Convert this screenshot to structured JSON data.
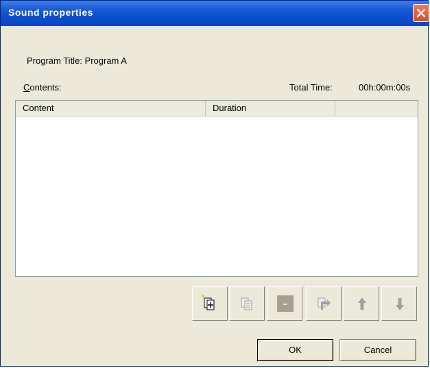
{
  "window": {
    "title": "Sound properties",
    "close_icon": "close-icon"
  },
  "program_title": {
    "text": "Program Title: Program A"
  },
  "contents": {
    "label_first": "C",
    "label_rest": "ontents:"
  },
  "total_time": {
    "label": "Total Time:",
    "value": "00h:00m:00s"
  },
  "list": {
    "columns": [
      "Content",
      "Duration",
      ""
    ],
    "rows": []
  },
  "toolbar": {
    "buttons": [
      {
        "name": "add-content-button",
        "icon": "add-item-icon",
        "enabled": true
      },
      {
        "name": "copy-content-button",
        "icon": "copy-icon",
        "enabled": false
      },
      {
        "name": "remove-content-button",
        "icon": "remove-icon",
        "enabled": false
      },
      {
        "name": "replace-content-button",
        "icon": "replace-icon",
        "enabled": false
      },
      {
        "name": "move-up-button",
        "icon": "arrow-up-icon",
        "enabled": false
      },
      {
        "name": "move-down-button",
        "icon": "arrow-down-icon",
        "enabled": false
      }
    ]
  },
  "footer": {
    "ok_label": "OK",
    "cancel_label": "Cancel"
  }
}
